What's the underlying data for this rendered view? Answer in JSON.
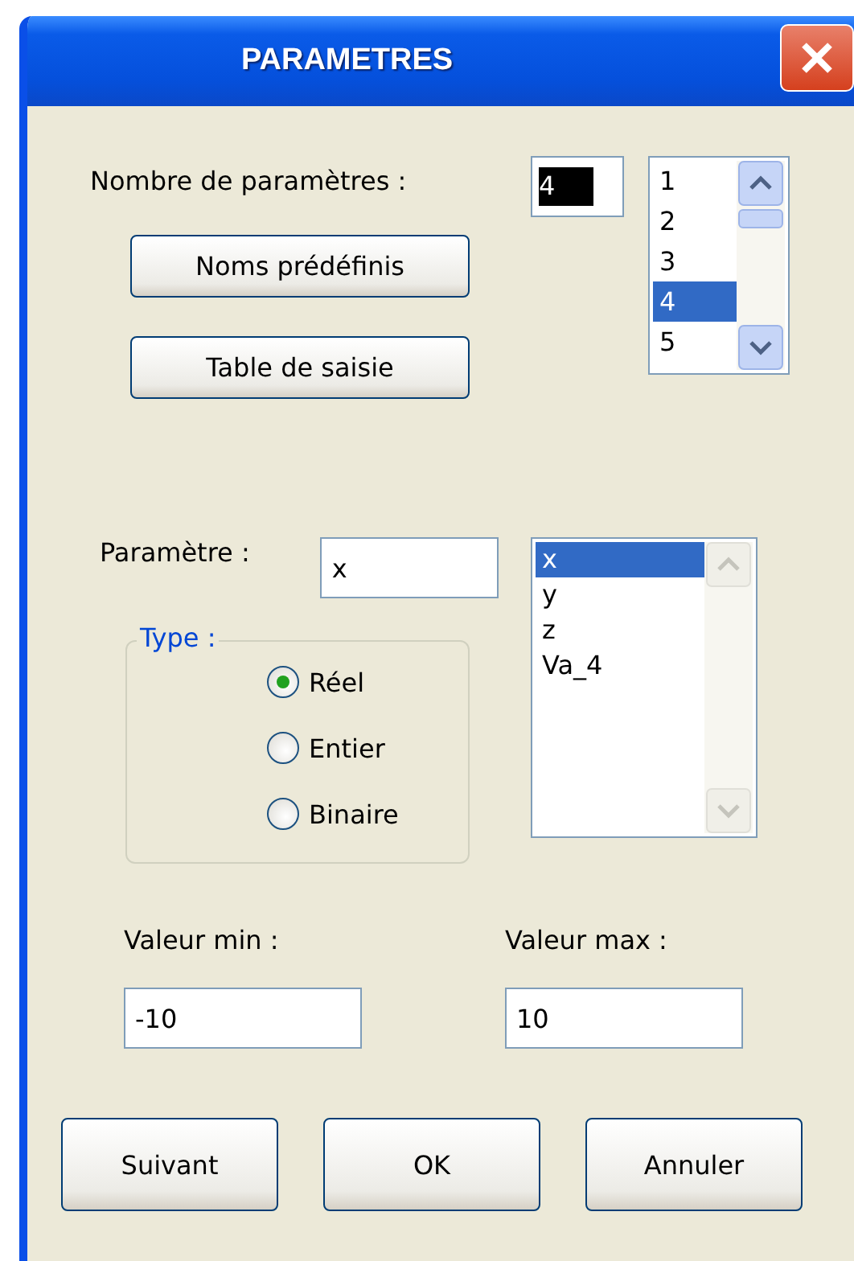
{
  "window": {
    "title": "PARAMETRES"
  },
  "count": {
    "label": "Nombre de paramètres :",
    "value": "4",
    "text_selected": true,
    "items": [
      {
        "label": "1",
        "selected": false
      },
      {
        "label": "2",
        "selected": false
      },
      {
        "label": "3",
        "selected": false
      },
      {
        "label": "4",
        "selected": true
      },
      {
        "label": "5",
        "selected": false
      }
    ]
  },
  "tools": [
    "Noms prédéfinis",
    "Table de saisie"
  ],
  "parameter": {
    "label": "Paramètre :",
    "value": "x",
    "items": [
      {
        "label": "x",
        "selected": true
      },
      {
        "label": "y",
        "selected": false
      },
      {
        "label": "z",
        "selected": false
      },
      {
        "label": "Va_4",
        "selected": false
      }
    ]
  },
  "type_group": {
    "legend": "Type :",
    "options": [
      {
        "label": "Réel",
        "selected": true
      },
      {
        "label": "Entier",
        "selected": false
      },
      {
        "label": "Binaire",
        "selected": false
      }
    ]
  },
  "range": [
    {
      "label": "Valeur min :",
      "value": "-10"
    },
    {
      "label": "Valeur max :",
      "value": "10"
    }
  ],
  "buttons": [
    "Suivant",
    "OK",
    "Annuler"
  ]
}
